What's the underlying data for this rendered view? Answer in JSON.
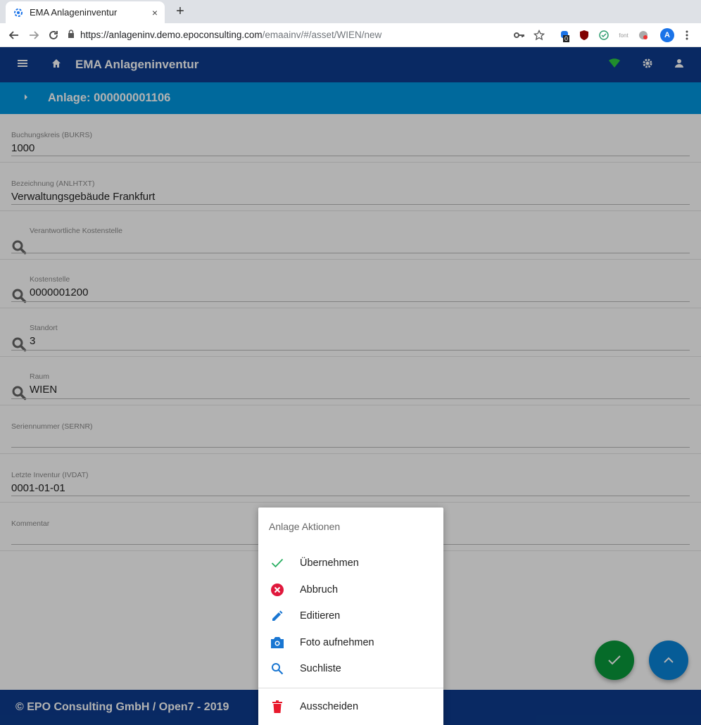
{
  "browser": {
    "tab_title": "EMA Anlageninventur",
    "close_glyph": "×",
    "newtab_glyph": "+",
    "url_domain": "https://anlageninv.demo.epoconsulting.com",
    "url_path": "/emaainv/#/asset/WIEN/new",
    "ext_badge": "0",
    "ext_font_label": "font",
    "avatar_letter": "A"
  },
  "app": {
    "title": "EMA Anlageninventur",
    "asset_title": "Anlage: 000000001106"
  },
  "form": {
    "fields": [
      {
        "label": "Buchungskreis (BUKRS)",
        "value": "1000"
      },
      {
        "label": "Bezeichnung (ANLHTXT)",
        "value": "Verwaltungsgebäude Frankfurt"
      },
      {
        "label": "Verantwortliche Kostenstelle",
        "value": ""
      },
      {
        "label": "Kostenstelle",
        "value": "0000001200"
      },
      {
        "label": "Standort",
        "value": "3"
      },
      {
        "label": "Raum",
        "value": "WIEN"
      },
      {
        "label": "Seriennummer (SERNR)",
        "value": ""
      },
      {
        "label": "Letzte Inventur (IVDAT)",
        "value": "0001-01-01"
      },
      {
        "label": "Kommentar",
        "value": ""
      }
    ]
  },
  "sheet": {
    "title": "Anlage Aktionen",
    "items": [
      {
        "label": "Übernehmen",
        "icon": "check-icon"
      },
      {
        "label": "Abbruch",
        "icon": "cancel-icon"
      },
      {
        "label": "Editieren",
        "icon": "pencil-icon"
      },
      {
        "label": "Foto aufnehmen",
        "icon": "camera-icon"
      },
      {
        "label": "Suchliste",
        "icon": "search-icon"
      },
      {
        "label": "Ausscheiden",
        "icon": "trash-icon"
      }
    ]
  },
  "footer": {
    "text": "© EPO Consulting GmbH / Open7 - 2019"
  },
  "colors": {
    "header": "#0d3c8e",
    "subheader": "#0097e0",
    "fab_ok": "#0a9a3b",
    "fab_up": "#0a85d8",
    "cancel_red": "#e0183c",
    "trash_red": "#e8192c",
    "icon_blue": "#1976d2",
    "check_green": "#27ae60"
  }
}
